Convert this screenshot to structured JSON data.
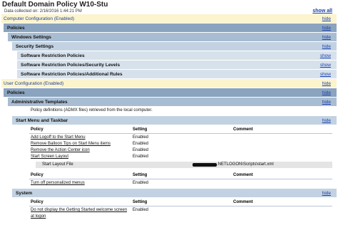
{
  "report": {
    "title": "Default Domain Policy W10-Stu",
    "collected": "Data collected on: 2/16/2016 1:44:21 PM",
    "show_all": "show all"
  },
  "computer": {
    "header": "Computer Configuration (Enabled)",
    "toggle": "hide",
    "policies": {
      "label": "Policies",
      "toggle": "hide"
    },
    "windows_settings": {
      "label": "Windows Settings",
      "toggle": "hide"
    },
    "security_settings": {
      "label": "Security Settings",
      "toggle": "hide"
    },
    "items": [
      {
        "label": "Software Restriction Policies",
        "toggle": "show"
      },
      {
        "label": "Software Restriction Policies/Security Levels",
        "toggle": "show"
      },
      {
        "label": "Software Restriction Policies/Additional Rules",
        "toggle": "show"
      }
    ]
  },
  "user": {
    "header": "User Configuration (Enabled)",
    "toggle": "hide",
    "policies": {
      "label": "Policies",
      "toggle": "hide"
    },
    "admin_templates": {
      "label": "Administrative Templates",
      "toggle": "hide",
      "note": "Policy definitions (ADMX files) retrieved from the local computer."
    },
    "start_menu": {
      "label": "Start Menu and Taskbar",
      "toggle": "hide",
      "columns": [
        "Policy",
        "Setting",
        "Comment"
      ],
      "rows": [
        {
          "policy": "Add Logoff to the Start Menu",
          "setting": "Enabled"
        },
        {
          "policy": "Remove Balloon Tips on Start Menu items",
          "setting": "Enabled"
        },
        {
          "policy": "Remove the Action Center icon",
          "setting": "Enabled"
        },
        {
          "policy": "Start Screen Layout",
          "setting": "Enabled"
        }
      ],
      "layout_file": {
        "label": "Start Layout File",
        "value": ".NETLOGON\\Scripts\\start.xml"
      },
      "columns2": [
        "Policy",
        "Setting",
        "Comment"
      ],
      "rows2": [
        {
          "policy": "Turn off personalized menus",
          "setting": "Enabled"
        }
      ]
    },
    "system": {
      "label": "System",
      "toggle": "hide",
      "columns": [
        "Policy",
        "Setting",
        "Comment"
      ],
      "rows": [
        {
          "policy": "Do not display the Getting Started welcome screen",
          "policy2": "at logon",
          "setting": "Enabled"
        }
      ]
    }
  }
}
